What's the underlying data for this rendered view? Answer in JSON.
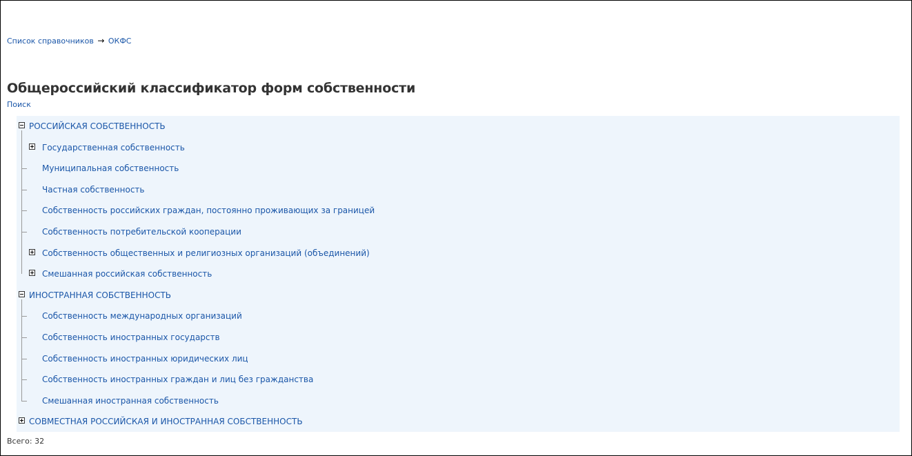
{
  "breadcrumb": {
    "root": "Список справочников",
    "arrow": "→",
    "current": "ОКФС"
  },
  "title": "Общероссийский классификатор форм собственности",
  "search_link": "Поиск",
  "tree": {
    "groups": [
      {
        "label": "РОССИЙСКАЯ СОБСТВЕННОСТЬ",
        "state": "expanded",
        "children": [
          {
            "label": "Государственная собственность",
            "state": "collapsed"
          },
          {
            "label": "Муниципальная собственность",
            "state": "leaf"
          },
          {
            "label": "Частная собственность",
            "state": "leaf"
          },
          {
            "label": "Собственность российских граждан, постоянно проживающих за границей",
            "state": "leaf"
          },
          {
            "label": "Собственность потребительской кооперации",
            "state": "leaf"
          },
          {
            "label": "Собственность общественных и религиозных организаций (объединений)",
            "state": "collapsed"
          },
          {
            "label": "Смешанная российская собственность",
            "state": "collapsed"
          }
        ]
      },
      {
        "label": "ИНОСТРАННАЯ СОБСТВЕННОСТЬ",
        "state": "expanded",
        "children": [
          {
            "label": "Собственность международных организаций",
            "state": "leaf"
          },
          {
            "label": "Собственность иностранных государств",
            "state": "leaf"
          },
          {
            "label": "Собственность иностранных юридических лиц",
            "state": "leaf"
          },
          {
            "label": "Собственность иностранных граждан и лиц без гражданства",
            "state": "leaf"
          },
          {
            "label": "Смешанная иностранная собственность",
            "state": "leaf"
          }
        ]
      },
      {
        "label": "СОВМЕСТНАЯ РОССИЙСКАЯ И ИНОСТРАННАЯ СОБСТВЕННОСТЬ",
        "state": "collapsed",
        "children": []
      }
    ]
  },
  "total": {
    "label": "Всего:",
    "count": "32"
  },
  "colors": {
    "link": "#1a56a8",
    "tree_background": "#eef5fc",
    "title": "#333333"
  }
}
